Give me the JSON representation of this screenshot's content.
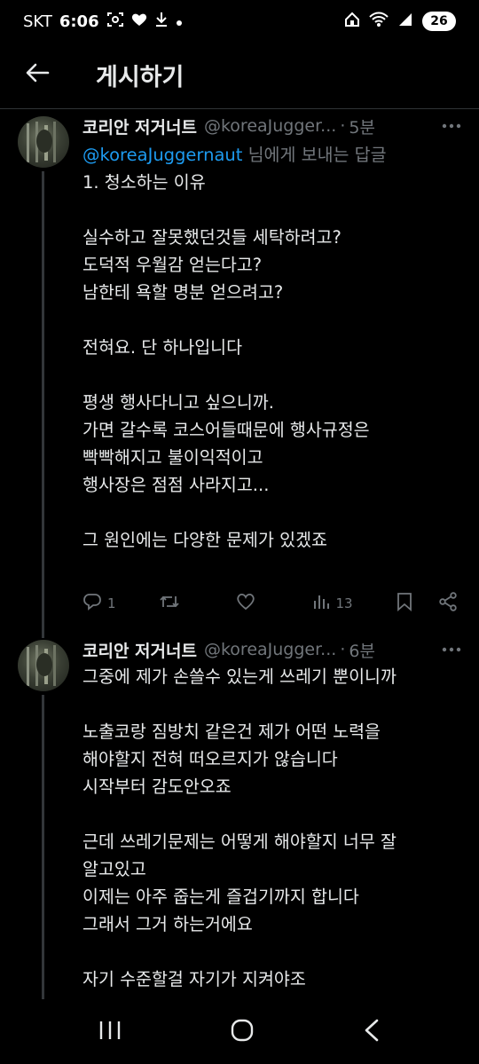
{
  "status": {
    "carrier": "SKT",
    "time": "6:06",
    "battery": "26",
    "left_icons": [
      "screenshot-icon",
      "heart-icon",
      "download-icon",
      "dot-icon"
    ],
    "right_icons": [
      "home-icon",
      "wifi-icon",
      "signal-icon"
    ]
  },
  "header": {
    "title": "게시하기",
    "back_icon": "arrow-left-icon"
  },
  "tweets": [
    {
      "author": "코리안 저거너트",
      "handle": "@koreaJugger...",
      "separator": "·",
      "time": "5분",
      "reply_mention": "@koreaJuggernaut",
      "reply_suffix": " 님에게 보내는 답글",
      "lines": [
        "1. 청소하는 이유",
        "",
        "실수하고 잘못했던것들 세탁하려고?",
        "도덕적 우월감 얻는다고?",
        "남한테 욕할 명분 얻으려고?",
        "",
        "전혀요. 단 하나입니다",
        "",
        "평생 행사다니고 싶으니까.",
        "가면 갈수록 코스어들때문에 행사규정은",
        "빡빡해지고 불이익적이고",
        "행사장은 점점 사라지고...",
        "",
        "그 원인에는 다양한 문제가 있겠죠"
      ],
      "actions": {
        "replies": "1",
        "retweets": "",
        "likes": "",
        "views": "13"
      }
    },
    {
      "author": "코리안 저거너트",
      "handle": "@koreaJugger...",
      "separator": "·",
      "time": "6분",
      "lines": [
        "그중에 제가 손쓸수 있는게 쓰레기 뿐이니까",
        "",
        "노출코랑 짐방치 같은건 제가 어떤 노력을",
        "해야할지 전혀 떠오르지가 않습니다",
        "시작부터 감도안오죠",
        "",
        "근데 쓰레기문제는 어떻게 해야할지 너무 잘",
        "알고있고",
        "이제는 아주 줍는게 즐겁기까지 합니다",
        "그래서 그거 하는거에요",
        "",
        "자기 수준할걸 자기가 지켜야조"
      ]
    }
  ],
  "nav": {
    "recent": "recents-icon",
    "home": "home-circle-icon",
    "back": "back-chevron-icon"
  }
}
